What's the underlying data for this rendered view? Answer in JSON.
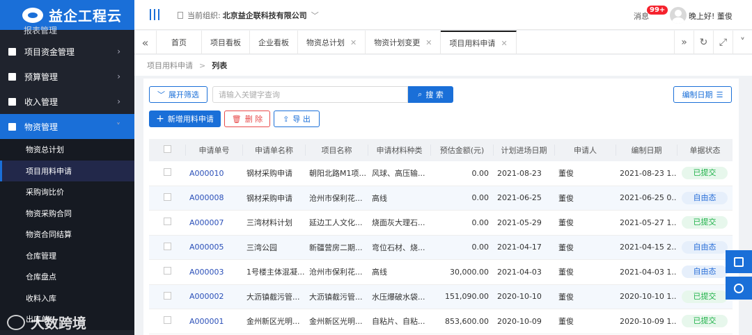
{
  "app": {
    "name": "益企工程云"
  },
  "sidebar": {
    "cut_item": "报表管理",
    "groups": [
      {
        "label": "项目资金管理"
      },
      {
        "label": "预算管理"
      },
      {
        "label": "收入管理"
      },
      {
        "label": "物资管理"
      }
    ],
    "sub_items": [
      {
        "label": "物资总计划"
      },
      {
        "label": "项目用料申请"
      },
      {
        "label": "采购询比价"
      },
      {
        "label": "物资采购合同"
      },
      {
        "label": "物资合同结算"
      },
      {
        "label": "仓库管理"
      },
      {
        "label": "仓库盘点"
      },
      {
        "label": "收料入库"
      },
      {
        "label": "出库单"
      }
    ]
  },
  "header": {
    "org_label": "当前组织:",
    "org_name": "北京益企联科技有限公司",
    "msg_label": "消息",
    "msg_badge": "99+",
    "greeting": "晚上好!",
    "user": "董俊"
  },
  "tabs": [
    {
      "label": "首页"
    },
    {
      "label": "项目看板"
    },
    {
      "label": "企业看板"
    },
    {
      "label": "物资总计划"
    },
    {
      "label": "物资计划变更"
    },
    {
      "label": "项目用料申请"
    }
  ],
  "breadcrumb": {
    "parent": "项目用料申请",
    "current": "列表"
  },
  "toolbar": {
    "filter": "展开筛选",
    "search_placeholder": "请输入关键字查询",
    "search_btn": "搜 索",
    "sort": "编制日期",
    "add": "新增用料申请",
    "delete": "删 除",
    "export": "导 出"
  },
  "table": {
    "headers": [
      "申请单号",
      "申请单名称",
      "项目名称",
      "申请材料种类",
      "预估金额(元)",
      "计划进场日期",
      "申请人",
      "编制日期",
      "单据状态"
    ],
    "rows": [
      [
        "A000010",
        "钢材采购申请",
        "朝阳北路M1项...",
        "风球、高压输...",
        "0.00",
        "2021-08-23",
        "董俊",
        "2021-08-23 1...",
        "已提交"
      ],
      [
        "A000008",
        "钢材采购申请",
        "沧州市保利花...",
        "高线",
        "0.00",
        "2021-06-25",
        "董俊",
        "2021-06-25 0...",
        "自由态"
      ],
      [
        "A000007",
        "三湾材料计划",
        "延边工人文化...",
        "烧面灰大理石...",
        "0.00",
        "2021-05-29",
        "董俊",
        "2021-05-27 1...",
        "已提交"
      ],
      [
        "A000005",
        "三湾公园",
        "新疆营房二期...",
        "弯位石材、烧...",
        "0.00",
        "2021-04-17",
        "董俊",
        "2021-04-15 2...",
        "自由态"
      ],
      [
        "A000003",
        "1号楼主体混凝...",
        "沧州市保利花...",
        "高线",
        "30,000.00",
        "2021-04-03",
        "董俊",
        "2021-04-03 1...",
        "自由态"
      ],
      [
        "A000002",
        "大沥镇截污管...",
        "大沥镇截污管...",
        "水压爆破水袋...",
        "151,090.00",
        "2020-10-10",
        "董俊",
        "2020-10-10 1...",
        "已提交"
      ],
      [
        "A000001",
        "金州新区光明...",
        "金州新区光明...",
        "自粘片、自粘...",
        "853,600.00",
        "2020-10-09",
        "董俊",
        "2020-10-09 1...",
        "已提交"
      ]
    ]
  },
  "watermark": "大数跨境",
  "colors": {
    "primary": "#1a6fd8",
    "sidebar": "#1f232d",
    "submitted": "#21b24a",
    "free": "#2a6fd8",
    "danger": "#e84a4a"
  }
}
